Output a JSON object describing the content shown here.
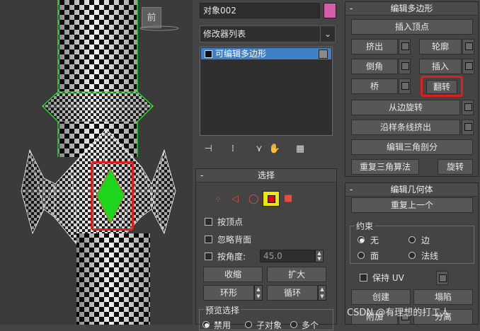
{
  "viewport": {
    "viewcube_label": "前"
  },
  "modify": {
    "object_name": "对象002",
    "object_color": "#d45ca8",
    "modifier_list": "修改器列表",
    "stack_item": "可编辑多边形"
  },
  "selection": {
    "title": "选择",
    "by_vertex": "按顶点",
    "ignore_backfacing": "忽略背面",
    "by_angle": "按角度:",
    "angle_value": "45.0",
    "shrink": "收缩",
    "grow": "扩大",
    "ring": "环形",
    "loop": "循环",
    "preview_title": "预览选择",
    "preview_off": "禁用",
    "preview_subobj": "子对象",
    "preview_multi": "多个"
  },
  "edit_polygons": {
    "title": "编辑多边形",
    "insert_vertex": "插入顶点",
    "extrude": "挤出",
    "outline": "轮廓",
    "bevel": "倒角",
    "inset": "插入",
    "bridge": "桥",
    "flip": "翻转",
    "hinge_from_edge": "从边旋转",
    "extrude_along_spline": "沿样条线挤出",
    "edit_triangulation": "编辑三角剖分",
    "retriangulate": "重复三角算法",
    "turn": "旋转"
  },
  "edit_geometry": {
    "title": "编辑几何体",
    "repeat_last": "重复上一个",
    "constraints_title": "约束",
    "none": "无",
    "edge": "边",
    "face": "面",
    "normal": "法线",
    "preserve_uv": "保持 UV",
    "create": "创建",
    "collapse": "塌陷",
    "attach": "附加",
    "detach": "分离"
  },
  "watermark": "CSDN @有理想的打工人",
  "colors": {
    "highlight": "#e11e1e",
    "selection_green": "#1ed51e",
    "stack_blue": "#3f80c8"
  }
}
